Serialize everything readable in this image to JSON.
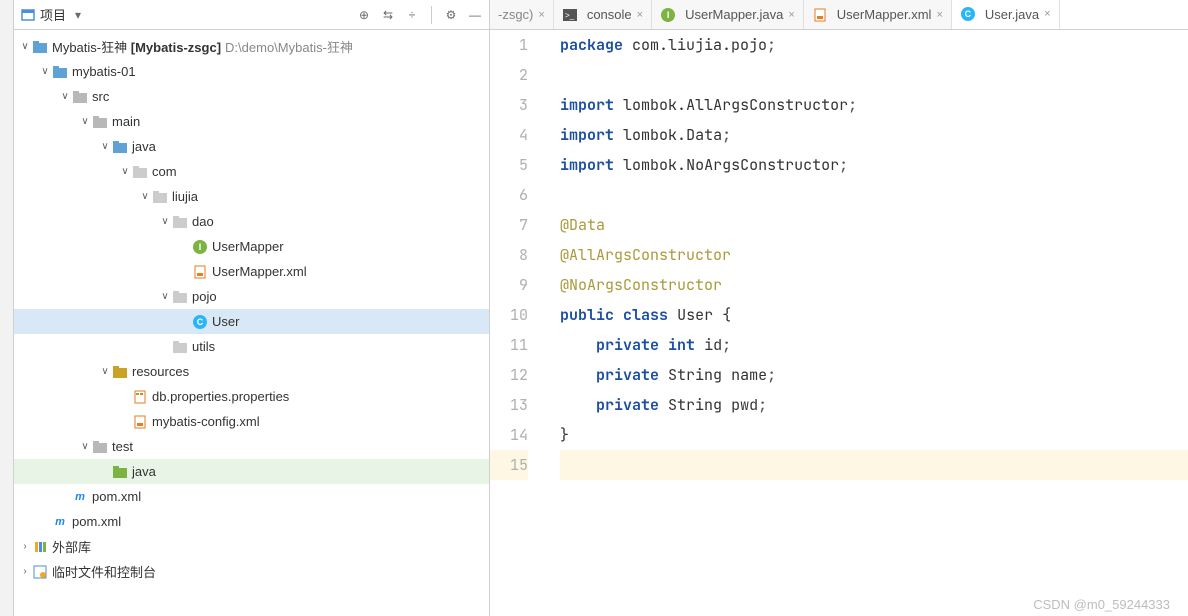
{
  "toolbar": {
    "project_label": "项目",
    "icons": {
      "target": "⊕",
      "collapse": "⇵",
      "divide": "÷",
      "gear": "⚙"
    }
  },
  "tree": {
    "root": {
      "name": "Mybatis-狂神",
      "module": "[Mybatis-zsgc]",
      "path": "D:\\demo\\Mybatis-狂神"
    },
    "mybatis01": "mybatis-01",
    "src": "src",
    "main": "main",
    "java1": "java",
    "com": "com",
    "liujia": "liujia",
    "dao": "dao",
    "usermapper_i": "UserMapper",
    "usermapper_xml": "UserMapper.xml",
    "pojo": "pojo",
    "user": "User",
    "utils": "utils",
    "resources": "resources",
    "db_props": "db.properties.properties",
    "mybatis_cfg": "mybatis-config.xml",
    "test": "test",
    "java2": "java",
    "pom1": "pom.xml",
    "pom2": "pom.xml",
    "ext_lib": "外部库",
    "scratch": "临时文件和控制台"
  },
  "tabs": {
    "partial": "-zsgc)",
    "console": "console",
    "usermapper_java": "UserMapper.java",
    "usermapper_xml": "UserMapper.xml",
    "user_java": "User.java"
  },
  "code": {
    "lines": [
      {
        "n": 1,
        "html": "<span class='kw'>package</span> <span class='pkg'>com.liujia.pojo</span><span class='semi'>;</span>"
      },
      {
        "n": 2,
        "html": ""
      },
      {
        "n": 3,
        "html": "<span class='kw'>import</span> <span class='pkg'>lombok</span>.<span class='type'>AllArgsConstructor</span><span class='semi'>;</span>"
      },
      {
        "n": 4,
        "html": "<span class='kw'>import</span> <span class='pkg'>lombok</span>.<span class='type'>Data</span><span class='semi'>;</span>"
      },
      {
        "n": 5,
        "html": "<span class='kw'>import</span> <span class='pkg'>lombok</span>.<span class='type'>NoArgsConstructor</span><span class='semi'>;</span>"
      },
      {
        "n": 6,
        "html": ""
      },
      {
        "n": 7,
        "html": "<span class='ann'>@Data</span>"
      },
      {
        "n": 8,
        "html": "<span class='ann'>@AllArgsConstructor</span>"
      },
      {
        "n": 9,
        "html": "<span class='ann'>@NoArgsConstructor</span>"
      },
      {
        "n": 10,
        "html": "<span class='kw'>public</span> <span class='kw'>class</span> <span class='type'>User</span> {"
      },
      {
        "n": 11,
        "html": "    <span class='kw'>private</span> <span class='kw'>int</span> <span class='type'>id</span><span class='semi'>;</span>"
      },
      {
        "n": 12,
        "html": "    <span class='kw'>private</span> <span class='type'>String</span> <span class='type'>name</span><span class='semi'>;</span>"
      },
      {
        "n": 13,
        "html": "    <span class='kw'>private</span> <span class='type'>String</span> <span class='type'>pwd</span><span class='semi'>;</span>"
      },
      {
        "n": 14,
        "html": "}"
      },
      {
        "n": 15,
        "html": ""
      }
    ],
    "current_line": 15
  },
  "watermark": "CSDN @m0_59244333"
}
